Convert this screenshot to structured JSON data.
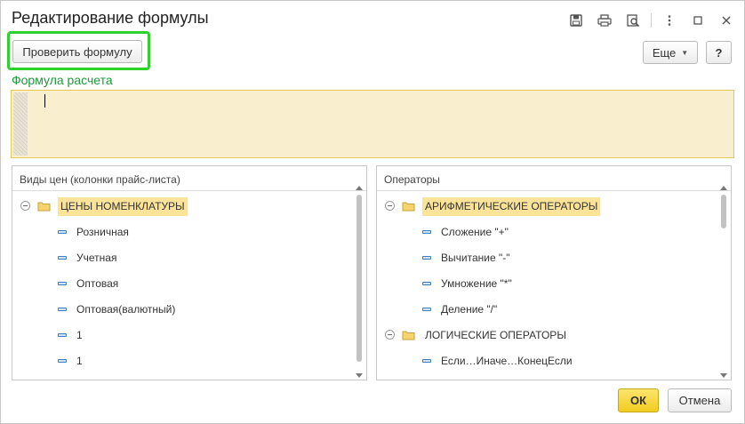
{
  "window": {
    "title": "Редактирование формулы"
  },
  "toolbar": {
    "check_formula_label": "Проверить формулу",
    "more_label": "Еще",
    "help_label": "?"
  },
  "formula": {
    "label": "Формула расчета",
    "value": ""
  },
  "price_types": {
    "header": "Виды цен (колонки прайс-листа)",
    "group": "ЦЕНЫ НОМЕНКЛАТУРЫ",
    "items": [
      "Розничная",
      "Учетная",
      "Оптовая",
      "Оптовая(валютный)",
      "1",
      "1"
    ]
  },
  "operators": {
    "header": "Операторы",
    "groups": [
      {
        "label": "АРИФМЕТИЧЕСКИЕ ОПЕРАТОРЫ",
        "items": [
          "Сложение \"+\"",
          "Вычитание \"-\"",
          "Умножение \"*\"",
          "Деление \"/\""
        ]
      },
      {
        "label": "ЛОГИЧЕСКИЕ ОПЕРАТОРЫ",
        "items": [
          "Если…Иначе…КонецЕсли"
        ]
      }
    ]
  },
  "footer": {
    "ok_label": "ОК",
    "cancel_label": "Отмена"
  },
  "colors": {
    "highlight": "#2ed12e",
    "formula_label": "#1a9a3a",
    "formula_bg": "#f9efcf",
    "selected_group": "#fbe39a",
    "ok_button": "#f2cb21"
  }
}
